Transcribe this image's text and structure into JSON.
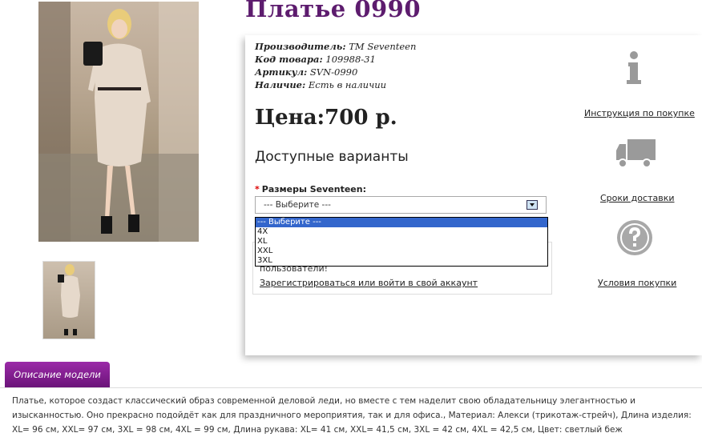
{
  "product": {
    "title": "Платье 0990",
    "manufacturer_label": "Производитель:",
    "manufacturer_value": "ТМ Seventeen",
    "code_label": "Код товара:",
    "code_value": "109988-31",
    "article_label": "Артикул:",
    "article_value": "SVN-0990",
    "stock_label": "Наличие:",
    "stock_value": "Есть в наличии",
    "price": "Цена:700 р."
  },
  "options": {
    "title": "Доступные варианты",
    "required_mark": "*",
    "size_label": "Размеры Seventeen:",
    "select_value": "--- Выберите ---",
    "dropdown_options": [
      "--- Выберите ---",
      "4X",
      "XL",
      "XXL",
      "3XL"
    ]
  },
  "login": {
    "note": "пользователи!",
    "link": "Зарегистрироваться или войти в свой аккаунт"
  },
  "sidebar": {
    "instructions": "Инструкция по покупке",
    "delivery": "Сроки доставки",
    "conditions": "Условия покупки"
  },
  "description": {
    "tab": "Описание модели",
    "text": "Платье, которое создаст классический образ современной деловой леди, но вместе с тем наделит свою обладательницу элегантностью и изысканностью. Оно прекрасно подойдёт как для праздничного мероприятия, так и для офиса., Материал: Алекси (трикотаж-стрейч), Длина изделия: XL= 96 см, XXL= 97 см, 3XL = 98 см, 4XL = 99 см, Длина рукава: XL= 41 см, XXL= 41,5 см, 3XL = 42 см, 4XL = 42,5 см, Цвет: светлый беж"
  }
}
